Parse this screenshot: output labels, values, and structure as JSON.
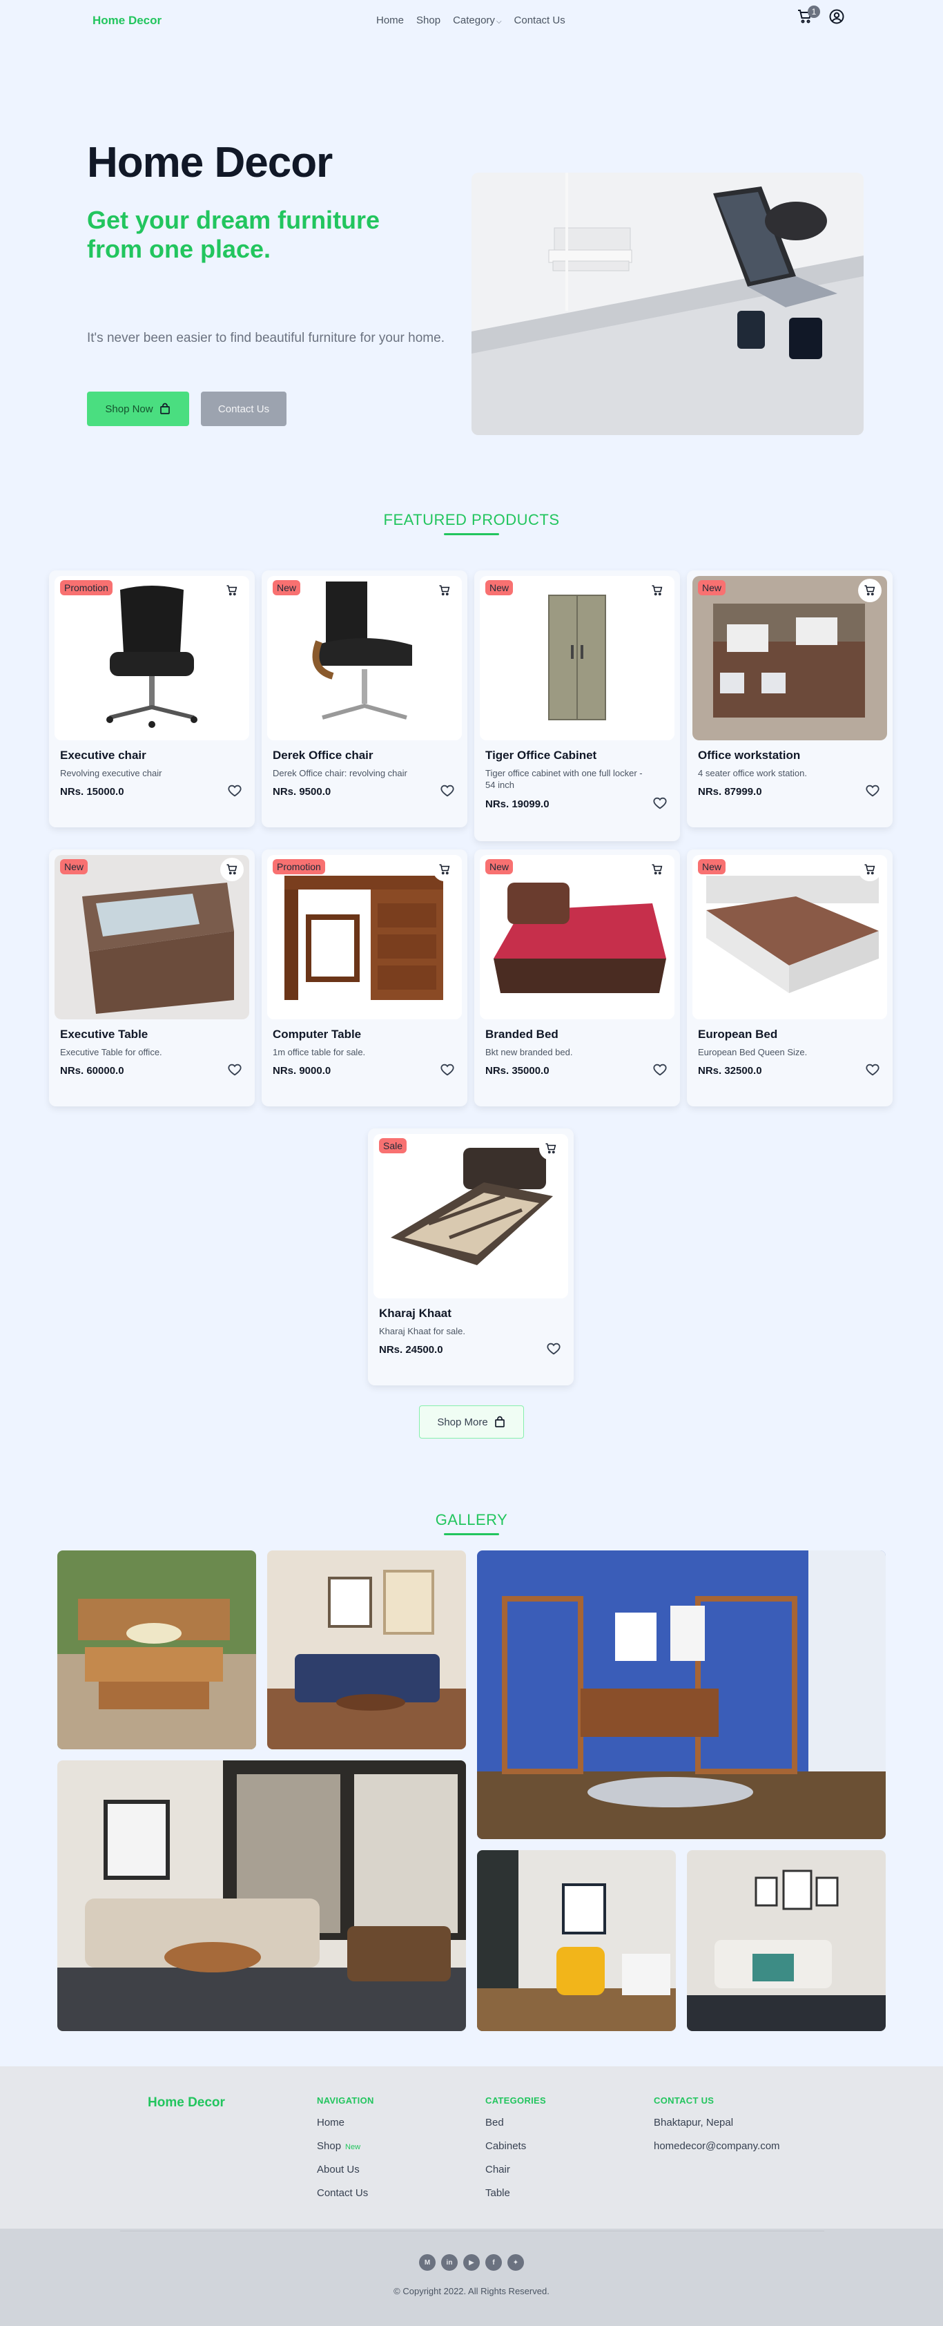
{
  "nav": {
    "brand": "Home Decor",
    "links": [
      "Home",
      "Shop",
      "Category",
      "Contact Us"
    ],
    "cart_count": "1"
  },
  "hero": {
    "title": "Home Decor",
    "subtitle": "Get your dream furniture from one place.",
    "description": "It's never been easier to find beautiful furniture for your home.",
    "shop_button": "Shop Now",
    "contact_button": "Contact Us"
  },
  "featured": {
    "title": "FEATURED PRODUCTS",
    "products": [
      {
        "tag": "Promotion",
        "name": "Executive chair",
        "desc": "Revolving executive chair",
        "price": "NRs. 15000.0"
      },
      {
        "tag": "New",
        "name": "Derek Office chair",
        "desc": "Derek Office chair: revolving chair",
        "price": "NRs. 9500.0"
      },
      {
        "tag": "New",
        "name": "Tiger Office Cabinet",
        "desc": "Tiger office cabinet with one full locker - 54 inch",
        "price": "NRs. 19099.0"
      },
      {
        "tag": "New",
        "name": "Office workstation",
        "desc": "4 seater office work station.",
        "price": "NRs. 87999.0"
      },
      {
        "tag": "New",
        "name": "Executive Table",
        "desc": "Executive Table for office.",
        "price": "NRs. 60000.0"
      },
      {
        "tag": "Promotion",
        "name": "Computer Table",
        "desc": "1m office table for sale.",
        "price": "NRs. 9000.0"
      },
      {
        "tag": "New",
        "name": "Branded Bed",
        "desc": "Bkt new branded bed.",
        "price": "NRs. 35000.0"
      },
      {
        "tag": "New",
        "name": "European Bed",
        "desc": "European Bed Queen Size.",
        "price": "NRs. 32500.0"
      },
      {
        "tag": "Sale",
        "name": "Kharaj Khaat",
        "desc": "Kharaj Khaat for sale.",
        "price": "NRs. 24500.0"
      }
    ],
    "shop_more": "Shop More"
  },
  "gallery": {
    "title": "GALLERY"
  },
  "footer": {
    "brand": "Home Decor",
    "navigation": {
      "heading": "NAVIGATION",
      "items": [
        "Home",
        "Shop",
        "About Us",
        "Contact Us"
      ],
      "new_badge": "New"
    },
    "categories": {
      "heading": "CATEGORIES",
      "items": [
        "Bed",
        "Cabinets",
        "Chair",
        "Table"
      ]
    },
    "contact": {
      "heading": "CONTACT US",
      "address": "Bhaktapur, Nepal",
      "email": "homedecor@company.com"
    },
    "socials": [
      "M",
      "in",
      "yt",
      "f",
      "tw"
    ],
    "copyright": "© Copyright 2022. All Rights Reserved."
  }
}
